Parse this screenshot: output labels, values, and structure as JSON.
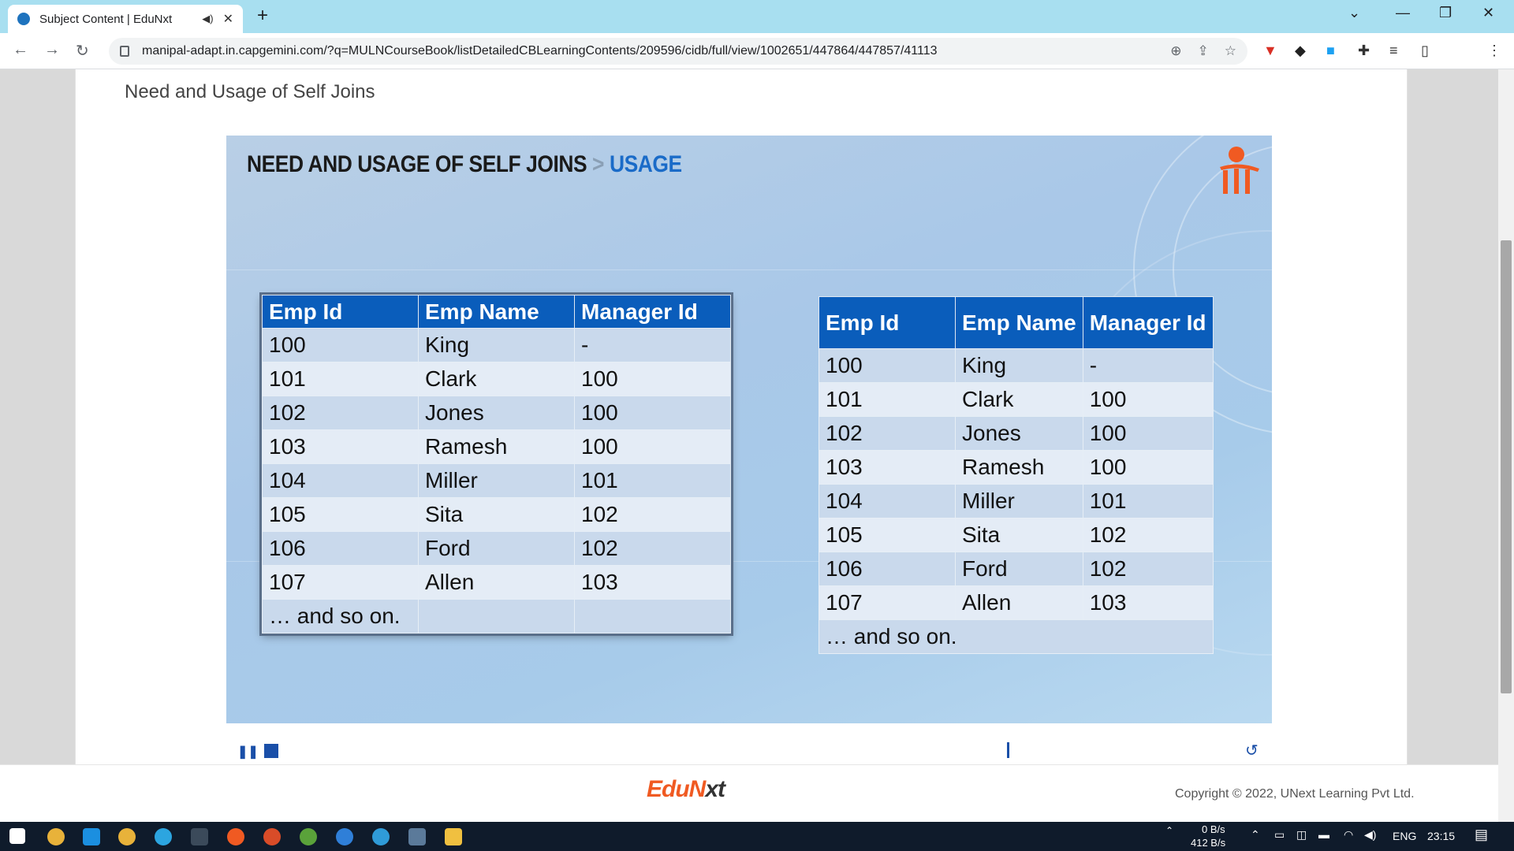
{
  "browser": {
    "tab_title": "Subject Content | EduNxt",
    "tab_audio_icon": "speaker-icon",
    "url": "manipal-adapt.in.capgemini.com/?q=MULNCourseBook/listDetailedCBLearningContents/209596/cidb/full/view/1002651/447864/447857/41113"
  },
  "page": {
    "heading": "Need and Usage of Self Joins"
  },
  "slide": {
    "title_main": "NEED AND USAGE OF SELF JOINS",
    "title_sep": ">",
    "title_sub": "USAGE"
  },
  "left_table": {
    "headers": [
      "Emp Id",
      "Emp Name",
      "Manager Id"
    ],
    "rows": [
      [
        "100",
        "King",
        "-"
      ],
      [
        "101",
        "Clark",
        "100"
      ],
      [
        "102",
        "Jones",
        "100"
      ],
      [
        "103",
        "Ramesh",
        "100"
      ],
      [
        "104",
        "Miller",
        "101"
      ],
      [
        "105",
        "Sita",
        "102"
      ],
      [
        "106",
        "Ford",
        "102"
      ],
      [
        "107",
        "Allen",
        "103"
      ],
      [
        "… and so on.",
        "",
        ""
      ]
    ]
  },
  "right_table": {
    "headers": [
      "Emp Id",
      "Emp Name",
      "Manager Id"
    ],
    "rows": [
      [
        "100",
        "King",
        "-"
      ],
      [
        "101",
        "Clark",
        "100"
      ],
      [
        "102",
        "Jones",
        "100"
      ],
      [
        "103",
        "Ramesh",
        "100"
      ],
      [
        "104",
        "Miller",
        "101"
      ],
      [
        "105",
        "Sita",
        "102"
      ],
      [
        "106",
        "Ford",
        "102"
      ],
      [
        "107",
        "Allen",
        "103"
      ]
    ],
    "footer_row": "… and so on."
  },
  "footer": {
    "logo_part1": "EduN",
    "logo_part2": "xt",
    "copyright": "Copyright © 2022, UNext Learning Pvt Ltd."
  },
  "taskbar": {
    "net_up": "0 B/s",
    "net_down": "412 B/s",
    "language": "ENG",
    "time": "23:15"
  },
  "colors": {
    "header_blue": "#0a5dbb",
    "title_blue": "#1a6bc8",
    "brand_orange": "#f05a22"
  }
}
